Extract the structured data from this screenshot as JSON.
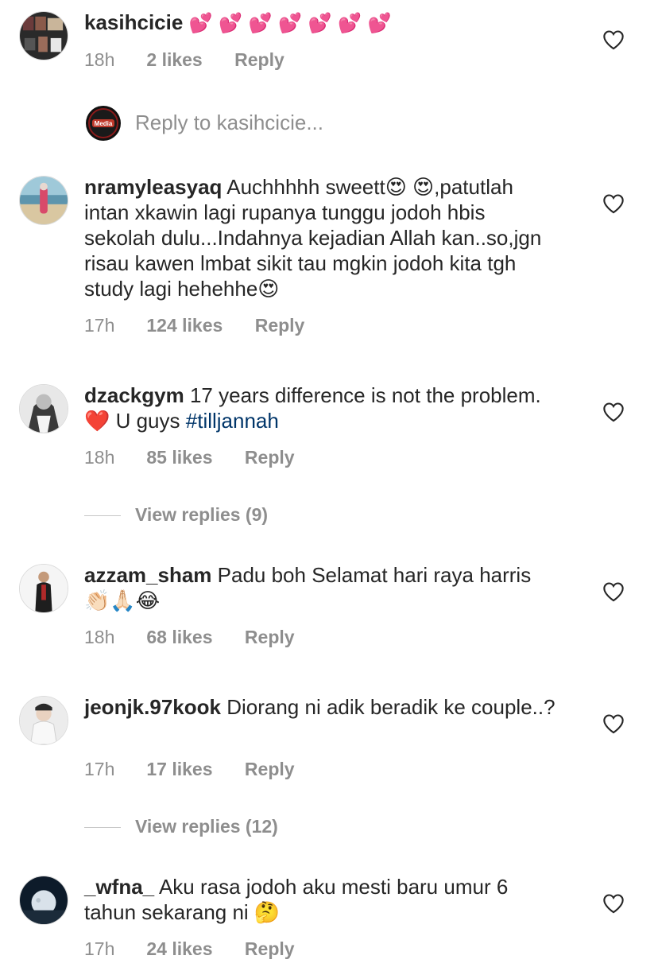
{
  "comments": [
    {
      "username": "kasihcicie",
      "text": "",
      "emoji": "💕 💕 💕 💕 💕 💕 💕",
      "time": "18h",
      "likes": "2 likes",
      "reply": "Reply"
    },
    {
      "username": "nramyleasyaq",
      "text": "Auchhhhh sweett😍 😍,patutlah intan xkawin lagi rupanya tunggu jodoh hbis sekolah dulu...Indahnya kejadian Allah kan..so,jgn risau kawen lmbat sikit tau mgkin jodoh kita tgh study lagi hehehhe😍",
      "time": "17h",
      "likes": "124 likes",
      "reply": "Reply"
    },
    {
      "username": "dzackgym",
      "text": "17 years difference is not the problem. ❤️ U guys",
      "hashtag": "#tilljannah",
      "time": "18h",
      "likes": "85 likes",
      "reply": "Reply",
      "view_replies": "View replies (9)"
    },
    {
      "username": "azzam_sham",
      "text": "Padu boh Selamat hari raya harris 👏🏻🙏🏻😂",
      "time": "18h",
      "likes": "68 likes",
      "reply": "Reply"
    },
    {
      "username": "jeonjk.97kook",
      "text": "Diorang ni adik beradik ke couple..?",
      "time": "17h",
      "likes": "17 likes",
      "reply": "Reply",
      "view_replies": "View replies (12)"
    },
    {
      "username": "_wfna_",
      "text": "Aku rasa jodoh aku mesti baru umur 6 tahun sekarang ni 🤔",
      "time": "17h",
      "likes": "24 likes",
      "reply": "Reply"
    }
  ],
  "reply_input": {
    "placeholder": "Reply to kasihcicie..."
  },
  "colors": {
    "text": "#262626",
    "secondary": "#8e8e8e",
    "hashtag": "#003569",
    "divider": "#c7c7c7"
  },
  "icons": {
    "like": "heart-outline-icon"
  }
}
